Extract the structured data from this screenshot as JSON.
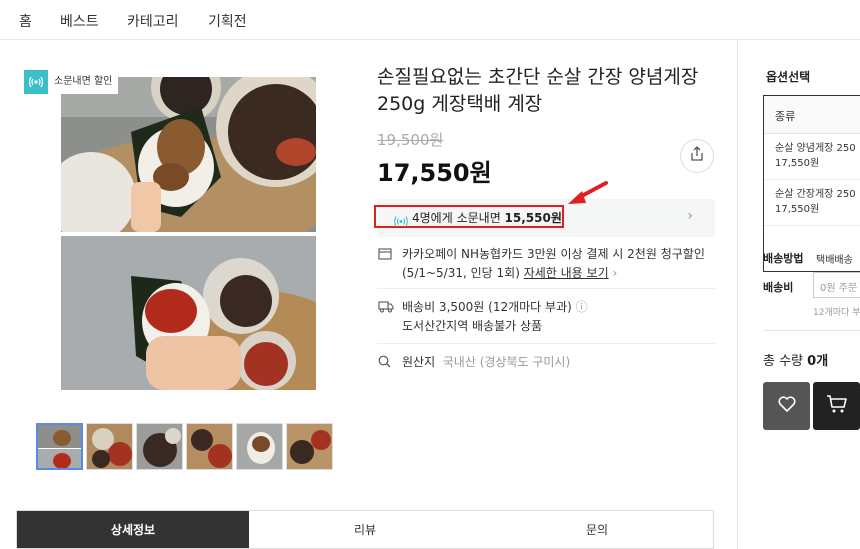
{
  "nav": {
    "items": [
      "홈",
      "베스트",
      "카테고리",
      "기획전"
    ]
  },
  "badge": {
    "label": "소문내면 할인",
    "color": "#3cc0c8"
  },
  "product": {
    "title": "손질필요없는 초간단 순살 간장 양념게장 250g 게장택배 계장",
    "original_price": "19,500원",
    "price": "17,550원"
  },
  "promo": {
    "prefix": "4명에게 소문내면 ",
    "amount": "15,550원",
    "highlight_color": "#e02020"
  },
  "card": {
    "text": "카카오페이 NH농협카드 3만원 이상 결제 시 2천원 청구할인 (5/1~5/31, 인당 1회) ",
    "link": "자세한 내용 보기"
  },
  "shipping": {
    "fee": "배송비 3,500원 (12개마다 부과)",
    "note": "도서산간지역 배송불가 상품"
  },
  "origin": {
    "label": "원산지",
    "value": "국내산 (경상북도 구미시)"
  },
  "tabs": [
    "상세정보",
    "리뷰",
    "문의"
  ],
  "options": {
    "title": "옵션선택",
    "header": "종류",
    "items": [
      {
        "name": "순살 양념게장 250",
        "price": "17,550원"
      },
      {
        "name": "순살 간장게장 250",
        "price": "17,550원"
      }
    ]
  },
  "delivery": {
    "method_label": "배송방법",
    "method_value": "택배배송",
    "fee_label": "배송비",
    "fee_value": "0원 주문",
    "fee_sub": "12개마다 부"
  },
  "total": {
    "label": "총 수량 ",
    "count": "0개"
  },
  "icons": [
    "broadcast-icon",
    "share-icon",
    "card-icon",
    "truck-icon",
    "info-icon",
    "search-icon",
    "heart-icon",
    "cart-icon",
    "chevron-right-icon",
    "red-arrow-icon"
  ]
}
